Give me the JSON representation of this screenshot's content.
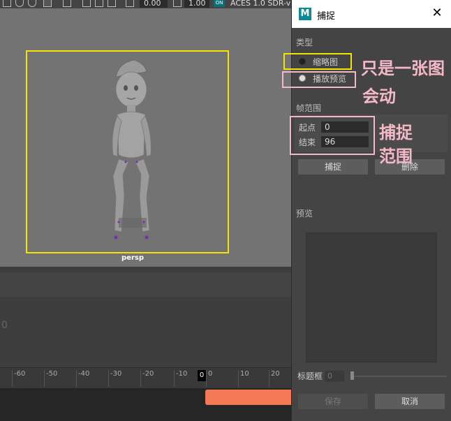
{
  "toolbar": {
    "field1_value": "0.00",
    "field2_value": "1.00",
    "badge": "ON",
    "color_space": "ACES 1.0 SDR-v"
  },
  "viewport": {
    "camera_label": "persp"
  },
  "timeline": {
    "ticks": [
      "-60",
      "-50",
      "-40",
      "-30",
      "-20",
      "-10",
      "0",
      "10",
      "20"
    ],
    "current_frame": "0",
    "ghost_text": "0"
  },
  "dialog": {
    "title": "捕捉",
    "logo": "M",
    "close_icon": "✕",
    "type_label": "类型",
    "radio_thumbnail": "缩略图",
    "radio_playblast": "播放预览",
    "frame_range_label": "帧范围",
    "start_label": "起点",
    "start_value": "0",
    "end_label": "结束",
    "end_value": "96",
    "capture_button": "捕捉",
    "delete_button": "删除",
    "preview_label": "预览",
    "caption_label": "标题框",
    "caption_value": "0",
    "save_button": "保存",
    "cancel_button": "取消"
  },
  "annotations": {
    "note1_line1": "只是一张图",
    "note1_line2": "会动",
    "note2_line1": "捕捉",
    "note2_line2": "范围"
  },
  "colors": {
    "annotation_yellow": "#f2e600",
    "annotation_pink": "#f5b8c8",
    "time_slider": "#f47a55",
    "maya_teal": "#0e8a95"
  }
}
